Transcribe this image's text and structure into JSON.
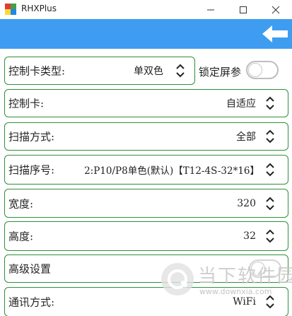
{
  "window": {
    "title": "RHXPlus"
  },
  "toolbar": {
    "back_icon": "arrow-left-icon",
    "color": "#3e9df0"
  },
  "fields": {
    "controller_type": {
      "label": "控制卡类型:",
      "value": "单双色"
    },
    "lock_screen": {
      "label": "锁定屏参",
      "on": false
    },
    "controller": {
      "label": "控制卡:",
      "value": "自适应"
    },
    "scan_mode": {
      "label": "扫描方式:",
      "value": "全部"
    },
    "scan_seq": {
      "label": "扫描序号:",
      "value": "2:P10/P8单色(默认)【T12-4S-32*16】"
    },
    "width": {
      "label": "宽度:",
      "value": "320"
    },
    "height": {
      "label": "高度:",
      "value": "32"
    },
    "advanced": {
      "label": "高级设置",
      "on": false
    },
    "comm_mode": {
      "label": "通讯方式:",
      "value": "WiFi"
    }
  },
  "watermark": {
    "text": "当下软件园",
    "url": "www.downxia.com"
  },
  "colors": {
    "accent": "#3e9df0",
    "border": "#2f8f3a"
  }
}
